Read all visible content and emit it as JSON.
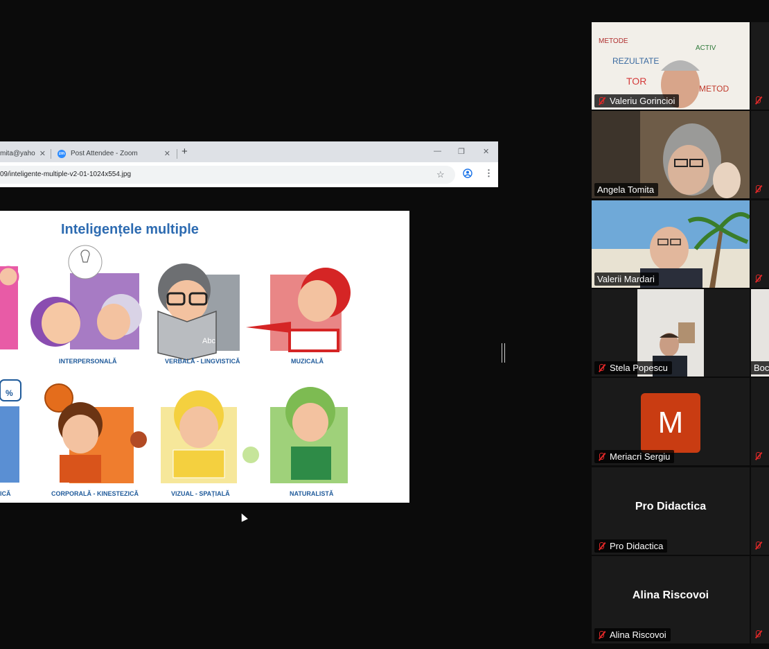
{
  "browser": {
    "tab1_title": "mita@yaho",
    "tab2_title": "Post Attendee - Zoom",
    "tab2_badge": "zm",
    "new_tab": "+",
    "url": "09/inteligente-multiple-v2-01-1024x554.jpg"
  },
  "slide": {
    "title": "Inteligențele multiple",
    "categories": [
      {
        "label": "INTERPERSONALĂ"
      },
      {
        "label": "VERBALĂ - LINGVISTICĂ"
      },
      {
        "label": "MUZICALĂ"
      },
      {
        "label": "ICĂ"
      },
      {
        "label": "CORPORALĂ - KINESTEZICĂ"
      },
      {
        "label": "VIZUAL - SPAȚIALĂ"
      },
      {
        "label": "NATURALISTĂ"
      }
    ],
    "math_symbol": "%",
    "book_text": "Abc"
  },
  "participants": [
    {
      "name": "Valeriu Gorincioi",
      "type": "video"
    },
    {
      "name": "Angela Tomita",
      "type": "video",
      "active": true
    },
    {
      "name": "Valerii Mardari",
      "type": "video"
    },
    {
      "name": "Stela Popescu",
      "type": "video"
    },
    {
      "name": "Meriacri Sergiu",
      "type": "avatar",
      "initial": "M"
    },
    {
      "name": "Pro Didactica",
      "type": "name-only",
      "display": "Pro Didactica"
    },
    {
      "name": "Alina Riscovoi",
      "type": "name-only",
      "display": "Alina Riscovoi"
    }
  ],
  "side_column": {
    "row4_name": "Boc"
  },
  "colors": {
    "active_border": "#23d959",
    "muted_mic": "#e02828",
    "avatar_bg": "#c93c12",
    "slide_title": "#2d6bb1"
  }
}
